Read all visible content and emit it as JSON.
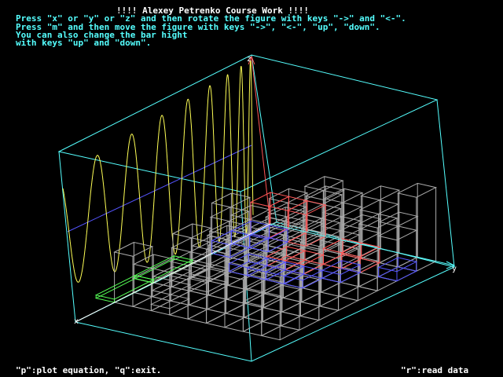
{
  "header": {
    "title": "!!!! Alexey Petrenko Course Work !!!!",
    "instructions": [
      "Press \"x\" or \"y\" or \"z\" and then rotate the figure with keys \"->\" and \"<-\".",
      "Press \"m\" and then move the figure with keys \"->\", \"<-\", \"up\", \"down\".",
      "You can also change the bar hight",
      "with keys \"up\" and \"down\"."
    ]
  },
  "footer": {
    "left_hint": "\"p\":plot equation, \"q\":exit.",
    "right_hint": "\"r\":read data"
  },
  "axes": {
    "x_label": "x",
    "y_label": "y",
    "z_label": "z"
  },
  "colors": {
    "background": "#000000",
    "box": "#55ffff",
    "axis_z": "#ff5555",
    "axis_x": "#ffffff",
    "axis_y": "#55ffff",
    "wave": "#ffff55",
    "bars_red": "#ff5555",
    "bars_blue": "#5555ff",
    "bars_white": "#aaaaaa",
    "bars_green": "#55ff55",
    "center_line": "#5555ff"
  }
}
